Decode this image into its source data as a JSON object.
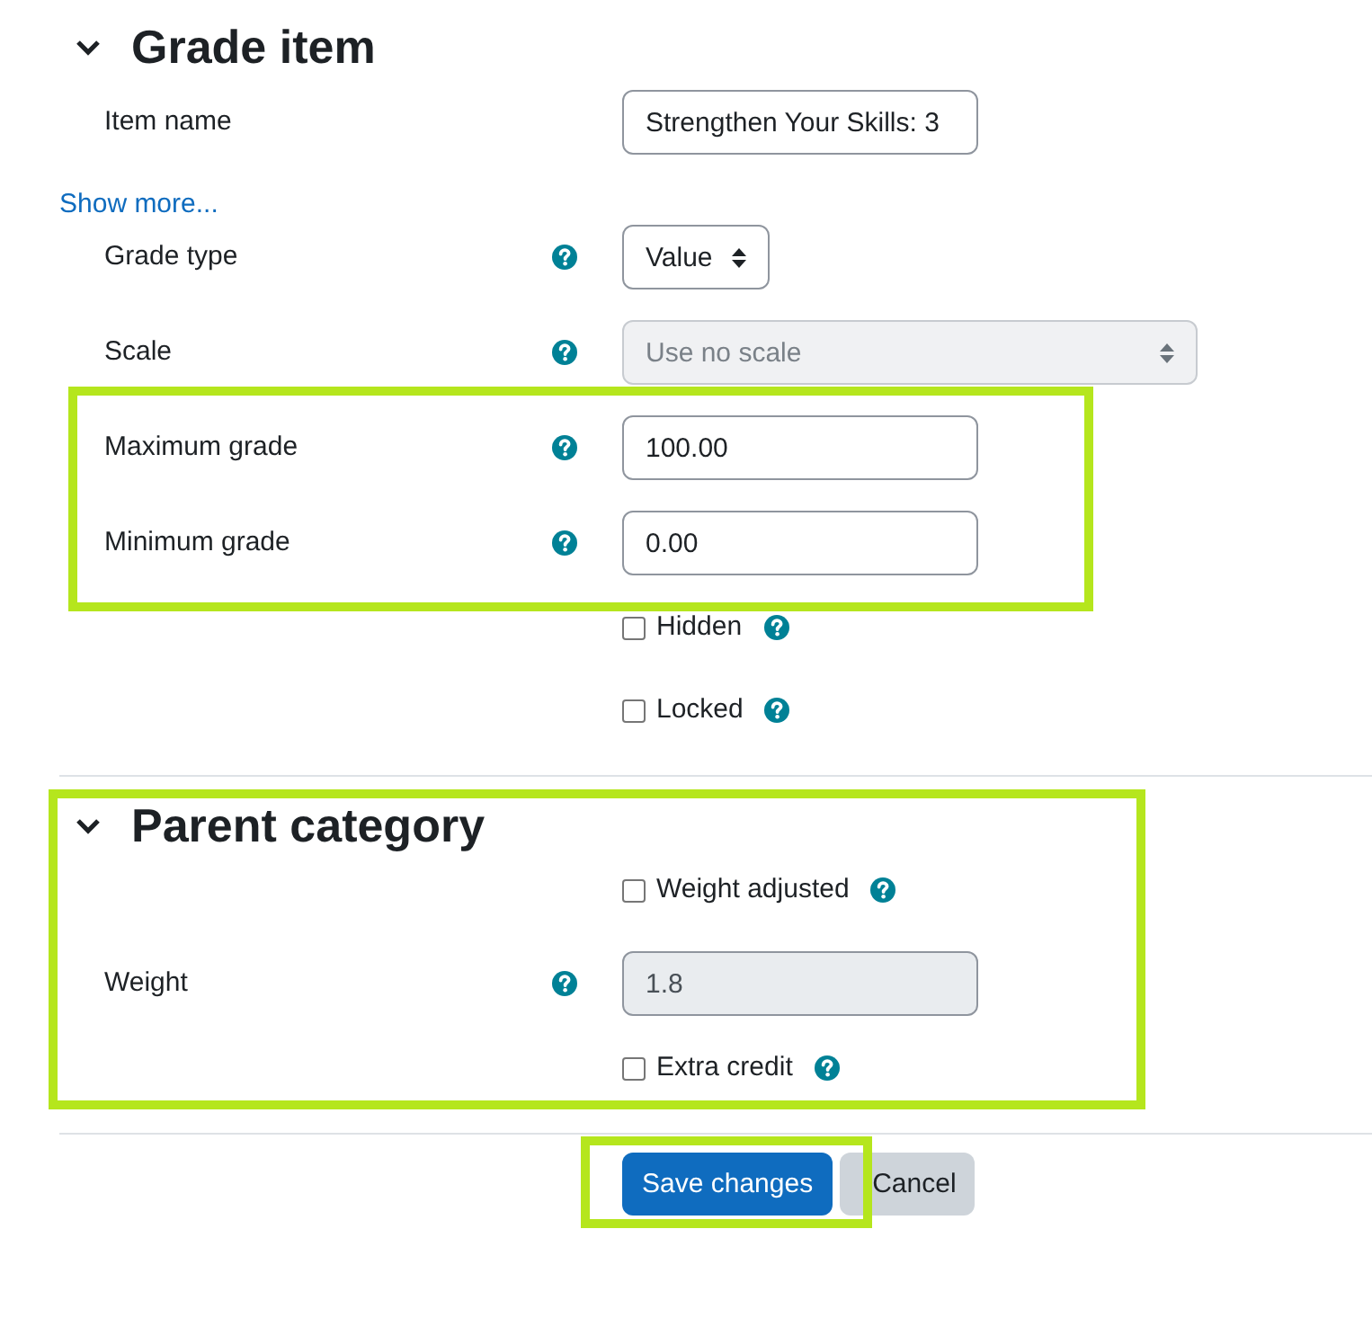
{
  "sections": [
    {
      "title": "Grade item",
      "expanded": true,
      "highlighted": false,
      "rows": [
        {
          "kind": "text",
          "label": "Item name",
          "help": false,
          "value": "Strengthen Your Skills: 3",
          "disabled": false
        },
        {
          "kind": "link",
          "label": "Show more..."
        },
        {
          "kind": "select",
          "label": "Grade type",
          "help": true,
          "value": "Value",
          "disabled": false
        },
        {
          "kind": "select",
          "label": "Scale",
          "help": true,
          "value": "Use no scale",
          "disabled": true
        },
        {
          "kind": "group",
          "highlighted": true,
          "rows": [
            {
              "kind": "text",
              "label": "Maximum grade",
              "help": true,
              "value": "100.00",
              "disabled": false
            },
            {
              "kind": "text",
              "label": "Minimum grade",
              "help": true,
              "value": "0.00",
              "disabled": false
            }
          ]
        },
        {
          "kind": "checkbox",
          "label": "Hidden",
          "checked": false,
          "help": true
        },
        {
          "kind": "checkbox",
          "label": "Locked",
          "checked": false,
          "help": true
        }
      ]
    },
    {
      "title": "Parent category",
      "expanded": true,
      "highlighted": true,
      "rows": [
        {
          "kind": "checkbox",
          "label": "Weight adjusted",
          "checked": false,
          "help": true
        },
        {
          "kind": "text",
          "label": "Weight",
          "help": true,
          "value": "1.8",
          "disabled": true
        },
        {
          "kind": "checkbox",
          "label": "Extra credit",
          "checked": false,
          "help": true
        }
      ]
    }
  ],
  "buttons": [
    {
      "label": "Save changes",
      "kind": "primary",
      "highlighted": true
    },
    {
      "label": "Cancel",
      "kind": "secondary",
      "highlighted": false
    }
  ]
}
